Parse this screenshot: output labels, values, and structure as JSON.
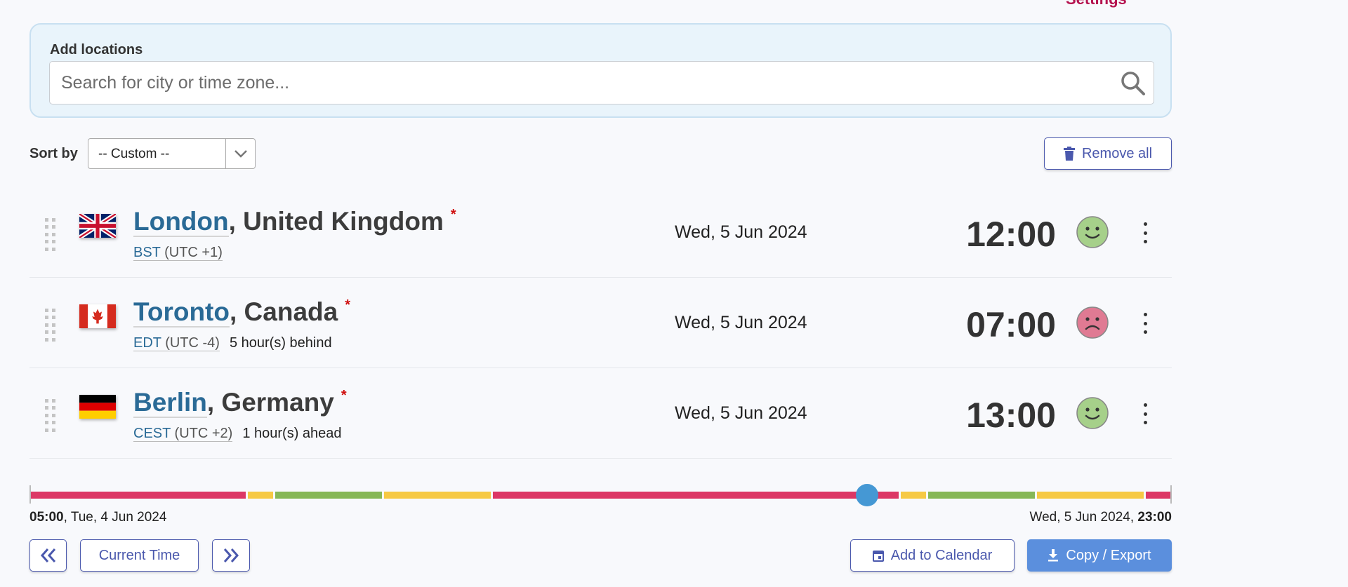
{
  "header": {
    "settings_label": "Settings"
  },
  "add_locations": {
    "label": "Add locations",
    "placeholder": "Search for city or time zone...",
    "icon": "search-icon"
  },
  "sort": {
    "label": "Sort by",
    "value": "-- Custom --"
  },
  "remove_all": "Remove all",
  "locations": [
    {
      "city": "London",
      "country": ", United Kingdom",
      "tz": "BST",
      "offset": "(UTC +1)",
      "diff": "",
      "date": "Wed, 5 Jun 2024",
      "time": "12:00",
      "mood": "happy",
      "flag": "uk"
    },
    {
      "city": "Toronto",
      "country": ", Canada",
      "tz": "EDT",
      "offset": "(UTC -4)",
      "diff": "5 hour(s) behind",
      "date": "Wed, 5 Jun 2024",
      "time": "07:00",
      "mood": "sad",
      "flag": "ca"
    },
    {
      "city": "Berlin",
      "country": ", Germany",
      "tz": "CEST",
      "offset": "(UTC +2)",
      "diff": "1 hour(s) ahead",
      "date": "Wed, 5 Jun 2024",
      "time": "13:00",
      "mood": "happy",
      "flag": "de"
    }
  ],
  "timeline": {
    "start_time": "05:00",
    "start_date": ", Tue, 4 Jun 2024",
    "end_date": "Wed, 5 Jun 2024, ",
    "end_time": "23:00",
    "total_hours": 42,
    "current_hour_offset": 30.8,
    "segments": [
      [
        "bad",
        8
      ],
      [
        "ok",
        1
      ],
      [
        "good",
        4
      ],
      [
        "ok",
        4
      ],
      [
        "bad",
        15
      ],
      [
        "ok",
        1
      ],
      [
        "good",
        4
      ],
      [
        "ok",
        4
      ],
      [
        "bad",
        1
      ]
    ],
    "colors": {
      "bad": "#dc3765",
      "ok": "#f6c944",
      "good": "#86b756"
    }
  },
  "buttons": {
    "current_time": "Current Time",
    "add_calendar": "Add to Calendar",
    "copy_export": "Copy / Export"
  },
  "colors": {
    "accent": "#4a58ad",
    "link": "#2a6a96",
    "knob": "#4598d4",
    "happy": "#a6d08a",
    "sad": "#e07a93"
  }
}
